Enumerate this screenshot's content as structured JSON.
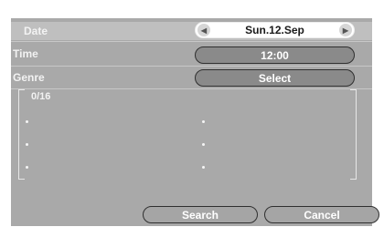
{
  "rows": {
    "date_label": "Date",
    "time_label": "Time",
    "genre_label": "Genre"
  },
  "date_selector": {
    "value": "Sun.12.Sep",
    "prev_icon": "triangle-left",
    "next_icon": "triangle-right"
  },
  "time_field": {
    "value": "12:00"
  },
  "genre_field": {
    "value": "Select"
  },
  "list": {
    "count": "0/16",
    "items": [
      "",
      "",
      "",
      "",
      "",
      ""
    ]
  },
  "buttons": {
    "search_label": "Search",
    "cancel_label": "Cancel"
  }
}
